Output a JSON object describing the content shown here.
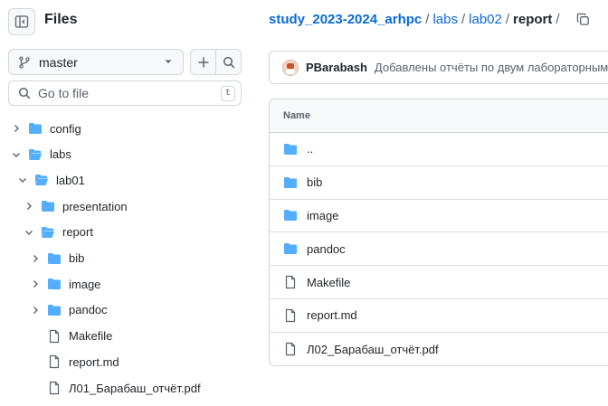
{
  "sidebar": {
    "title": "Files",
    "branch": "master",
    "goto_placeholder": "Go to file",
    "goto_shortcut": "t",
    "tree": [
      {
        "label": "config",
        "type": "folder",
        "depth": 0,
        "expanded": false
      },
      {
        "label": "labs",
        "type": "folder",
        "depth": 0,
        "expanded": true
      },
      {
        "label": "lab01",
        "type": "folder",
        "depth": 1,
        "expanded": true
      },
      {
        "label": "presentation",
        "type": "folder",
        "depth": 2,
        "expanded": false
      },
      {
        "label": "report",
        "type": "folder",
        "depth": 2,
        "expanded": true
      },
      {
        "label": "bib",
        "type": "folder",
        "depth": 3,
        "expanded": false
      },
      {
        "label": "image",
        "type": "folder",
        "depth": 3,
        "expanded": false
      },
      {
        "label": "pandoc",
        "type": "folder",
        "depth": 3,
        "expanded": false
      },
      {
        "label": "Makefile",
        "type": "file",
        "depth": 3
      },
      {
        "label": "report.md",
        "type": "file",
        "depth": 3
      },
      {
        "label": "Л01_Барабаш_отчёт.pdf",
        "type": "file",
        "depth": 3
      }
    ]
  },
  "breadcrumb": {
    "root": "study_2023-2024_arhpc",
    "parts": [
      "labs",
      "lab02"
    ],
    "current": "report",
    "trailing": "/"
  },
  "commit": {
    "author": "PBarabash",
    "message": "Добавлены отчёты по двум лабораторным"
  },
  "table": {
    "header": "Name",
    "rows": [
      {
        "name": "..",
        "type": "folder"
      },
      {
        "name": "bib",
        "type": "folder"
      },
      {
        "name": "image",
        "type": "folder"
      },
      {
        "name": "pandoc",
        "type": "folder"
      },
      {
        "name": "Makefile",
        "type": "file"
      },
      {
        "name": "report.md",
        "type": "file"
      },
      {
        "name": "Л02_Барабаш_отчёт.pdf",
        "type": "file"
      }
    ]
  },
  "colors": {
    "folder": "#54aeff",
    "link": "#0969da",
    "border": "#d0d7de",
    "muted": "#59636e"
  }
}
